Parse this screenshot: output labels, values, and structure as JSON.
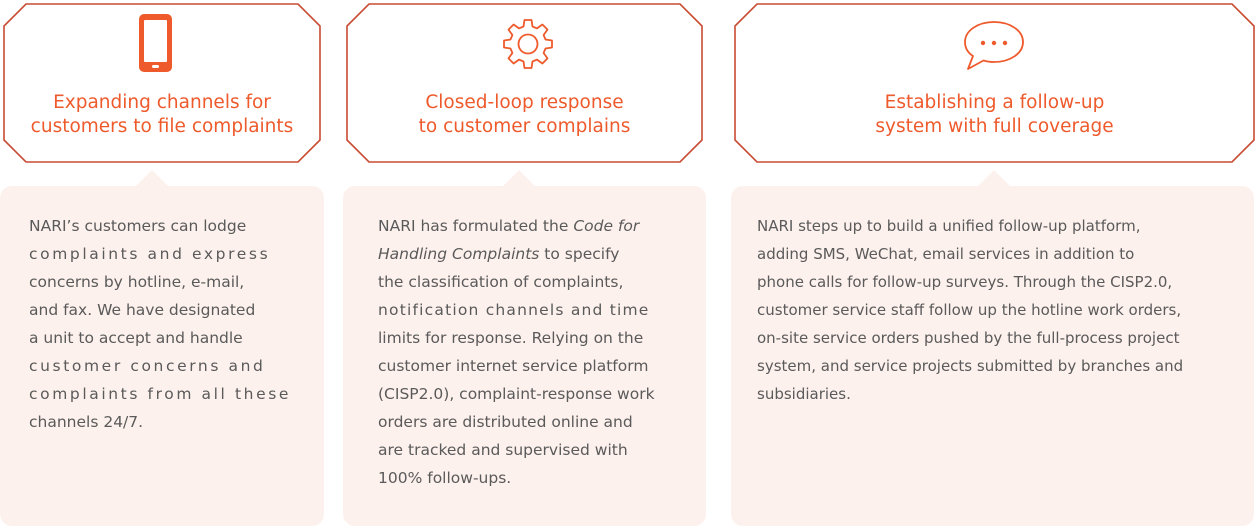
{
  "colors": {
    "accent": "#ee5a2c",
    "border": "#c84b33",
    "panel": "#fdf1ed",
    "text": "#5a5a5a"
  },
  "cards": [
    {
      "icon": "smartphone-icon",
      "title_lines": [
        "Expanding channels for",
        "customers to file complaints"
      ],
      "body_lines": [
        "NARI’s customers can lodge",
        "complaints and express",
        "concerns by hotline, e-mail,",
        "and fax. We have designated",
        "a unit to accept and handle",
        "customer concerns and",
        "complaints from all these",
        "channels 24/7."
      ]
    },
    {
      "icon": "gear-icon",
      "title_lines": [
        "Closed-loop response",
        "to customer complains"
      ],
      "body_lines": [
        "NARI has formulated the",
        "Code for",
        "Handling Complaints",
        "to specify",
        "the classification of complaints,",
        "notification channels and time",
        "limits for response. Relying on the",
        "customer internet service platform",
        "(CISP2.0), complaint-response work",
        "orders are distributed online and",
        "are tracked and supervised with",
        "100% follow-ups."
      ]
    },
    {
      "icon": "speech-bubble-icon",
      "title_lines": [
        "Establishing a follow-up",
        "system with full coverage"
      ],
      "body_lines": [
        "NARI steps up to build a unified follow-up platform,",
        "adding SMS, WeChat, email services in addition to",
        "phone calls for follow-up surveys. Through the CISP2.0,",
        "customer service staff follow up the hotline work orders,",
        "on-site service orders pushed by the full-process project",
        "system, and service projects submitted by branches and",
        "subsidiaries."
      ]
    }
  ]
}
